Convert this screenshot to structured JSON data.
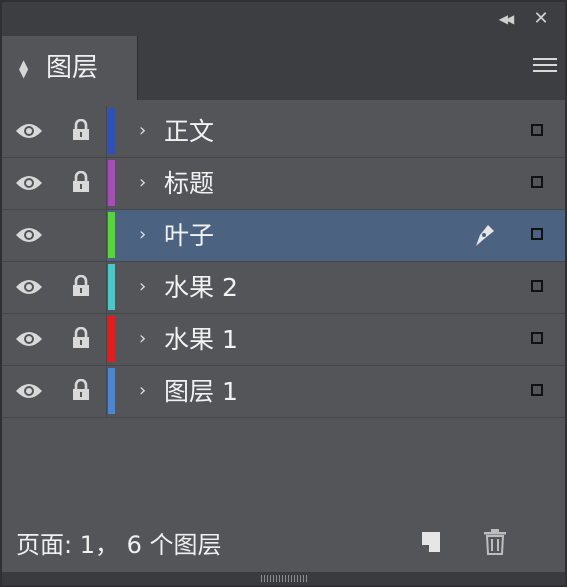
{
  "panel": {
    "tab_label": "图层",
    "collapse_icon": "double-chevron-left-icon",
    "close_icon": "close-icon",
    "menu_icon": "hamburger-menu-icon"
  },
  "layers": [
    {
      "name": "正文",
      "color": "#2f50b8",
      "locked": true,
      "visible": true,
      "selected": false
    },
    {
      "name": "标题",
      "color": "#a54fb5",
      "locked": true,
      "visible": true,
      "selected": false
    },
    {
      "name": "叶子",
      "color": "#5bd33f",
      "locked": false,
      "visible": true,
      "selected": true
    },
    {
      "name": "水果 2",
      "color": "#4ec6c7",
      "locked": true,
      "visible": true,
      "selected": false
    },
    {
      "name": "水果 1",
      "color": "#e01e1e",
      "locked": true,
      "visible": true,
      "selected": false
    },
    {
      "name": "图层 1",
      "color": "#4d86cf",
      "locked": true,
      "visible": true,
      "selected": false
    }
  ],
  "footer": {
    "status": "页面: 1， 6 个图层"
  }
}
